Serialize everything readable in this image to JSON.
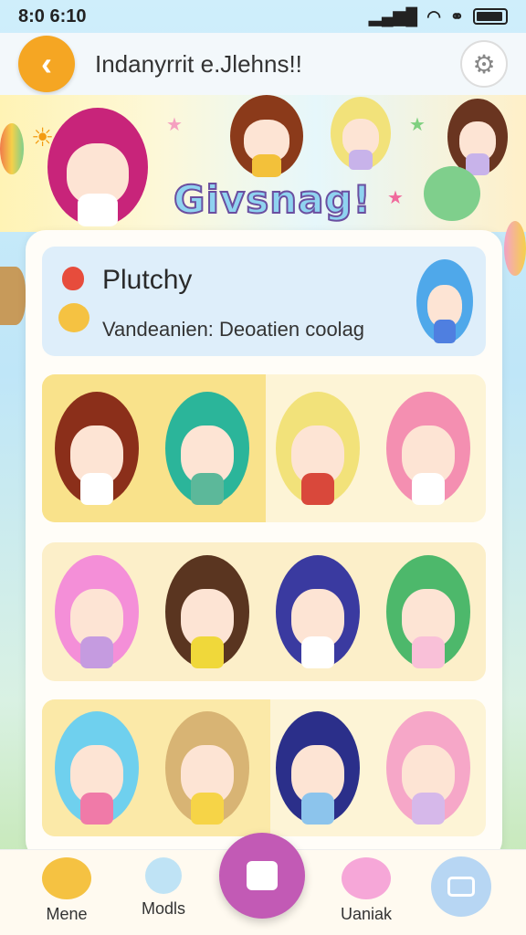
{
  "status_bar": {
    "time": "8:0 6:10",
    "signal_icon": "signal-bars-icon",
    "wifi_icon": "wifi-icon",
    "extra_icon": "link-icon",
    "battery_icon": "battery-icon"
  },
  "header": {
    "back_icon": "chevron-left-icon",
    "title": "Indanyrrit e.Jlehns!!",
    "settings_icon": "gear-icon",
    "accent_color": "#f5a623"
  },
  "banner": {
    "logo_text": "Givsnag!"
  },
  "info_card": {
    "title": "Plutchy",
    "subtitle": "Vandeanien: Deoatien coolag",
    "title_icon": "apple-icon",
    "subtitle_icon": "bear-icon"
  },
  "character_grid": {
    "rows": [
      {
        "characters": [
          {
            "hair": "#8b2f1a",
            "outfit": "#ffffff"
          },
          {
            "hair": "#2bb59a",
            "outfit": "#5cb89a"
          },
          {
            "hair": "#f2e27a",
            "outfit": "#d9483b"
          },
          {
            "hair": "#f48fb1",
            "outfit": "#ffffff"
          }
        ]
      },
      {
        "characters": [
          {
            "hair": "#f48fd8",
            "outfit": "#c59be0"
          },
          {
            "hair": "#5a3520",
            "outfit": "#f0d83a"
          },
          {
            "hair": "#3a3aa0",
            "outfit": "#ffffff"
          },
          {
            "hair": "#4db86b",
            "outfit": "#f9c0d8"
          }
        ]
      },
      {
        "characters": [
          {
            "hair": "#6fd0ee",
            "outfit": "#f07aa8"
          },
          {
            "hair": "#d8b474",
            "outfit": "#f6d447"
          },
          {
            "hair": "#2b2f8a",
            "outfit": "#8cc4ec"
          },
          {
            "hair": "#f6a7c8",
            "outfit": "#d6b8ea"
          }
        ]
      }
    ]
  },
  "nav": {
    "items": [
      {
        "label": "Mene",
        "icon": "pikachu-icon"
      },
      {
        "label": "Modls",
        "icon": "lollipop-icon"
      },
      {
        "label": "",
        "icon": "center-action-icon"
      },
      {
        "label": "Uaniak",
        "icon": "pig-icon"
      },
      {
        "label": "",
        "icon": "chat-icon"
      }
    ]
  }
}
